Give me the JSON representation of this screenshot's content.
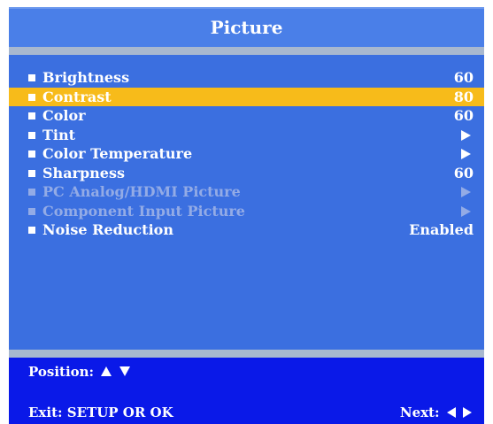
{
  "menu": {
    "title": "Picture",
    "items": [
      {
        "label": "Brightness",
        "value": "60",
        "kind": "value",
        "selected": false,
        "disabled": false,
        "name": "brightness"
      },
      {
        "label": "Contrast",
        "value": "80",
        "kind": "value",
        "selected": true,
        "disabled": false,
        "name": "contrast"
      },
      {
        "label": "Color",
        "value": "60",
        "kind": "value",
        "selected": false,
        "disabled": false,
        "name": "color"
      },
      {
        "label": "Tint",
        "value": null,
        "kind": "submenu",
        "selected": false,
        "disabled": false,
        "name": "tint"
      },
      {
        "label": "Color Temperature",
        "value": null,
        "kind": "submenu",
        "selected": false,
        "disabled": false,
        "name": "color-temperature"
      },
      {
        "label": "Sharpness",
        "value": "60",
        "kind": "value",
        "selected": false,
        "disabled": false,
        "name": "sharpness"
      },
      {
        "label": "PC Analog/HDMI Picture",
        "value": null,
        "kind": "submenu",
        "selected": false,
        "disabled": true,
        "name": "pc-analog-hdmi-picture"
      },
      {
        "label": "Component Input Picture",
        "value": null,
        "kind": "submenu",
        "selected": false,
        "disabled": true,
        "name": "component-input-picture"
      },
      {
        "label": "Noise Reduction",
        "value": "Enabled",
        "kind": "value",
        "selected": false,
        "disabled": false,
        "name": "noise-reduction"
      }
    ]
  },
  "footer": {
    "position_label": "Position:",
    "exit_label": "Exit: SETUP OR OK",
    "next_label": "Next:"
  },
  "icons": {
    "bullet": "square-bullet-icon",
    "submenu": "arrow-right-icon",
    "position": [
      "arrow-up-icon",
      "arrow-down-icon"
    ],
    "next": [
      "arrow-left-icon",
      "arrow-right-icon"
    ]
  },
  "colors": {
    "panel": "#3b6fe0",
    "title_bar": "#4a7fe8",
    "separator": "#a8b8cf",
    "highlight": "#f7bb1a",
    "disabled_text": "#93abe6",
    "footer": "#0a19e8",
    "text": "#ffffff"
  }
}
